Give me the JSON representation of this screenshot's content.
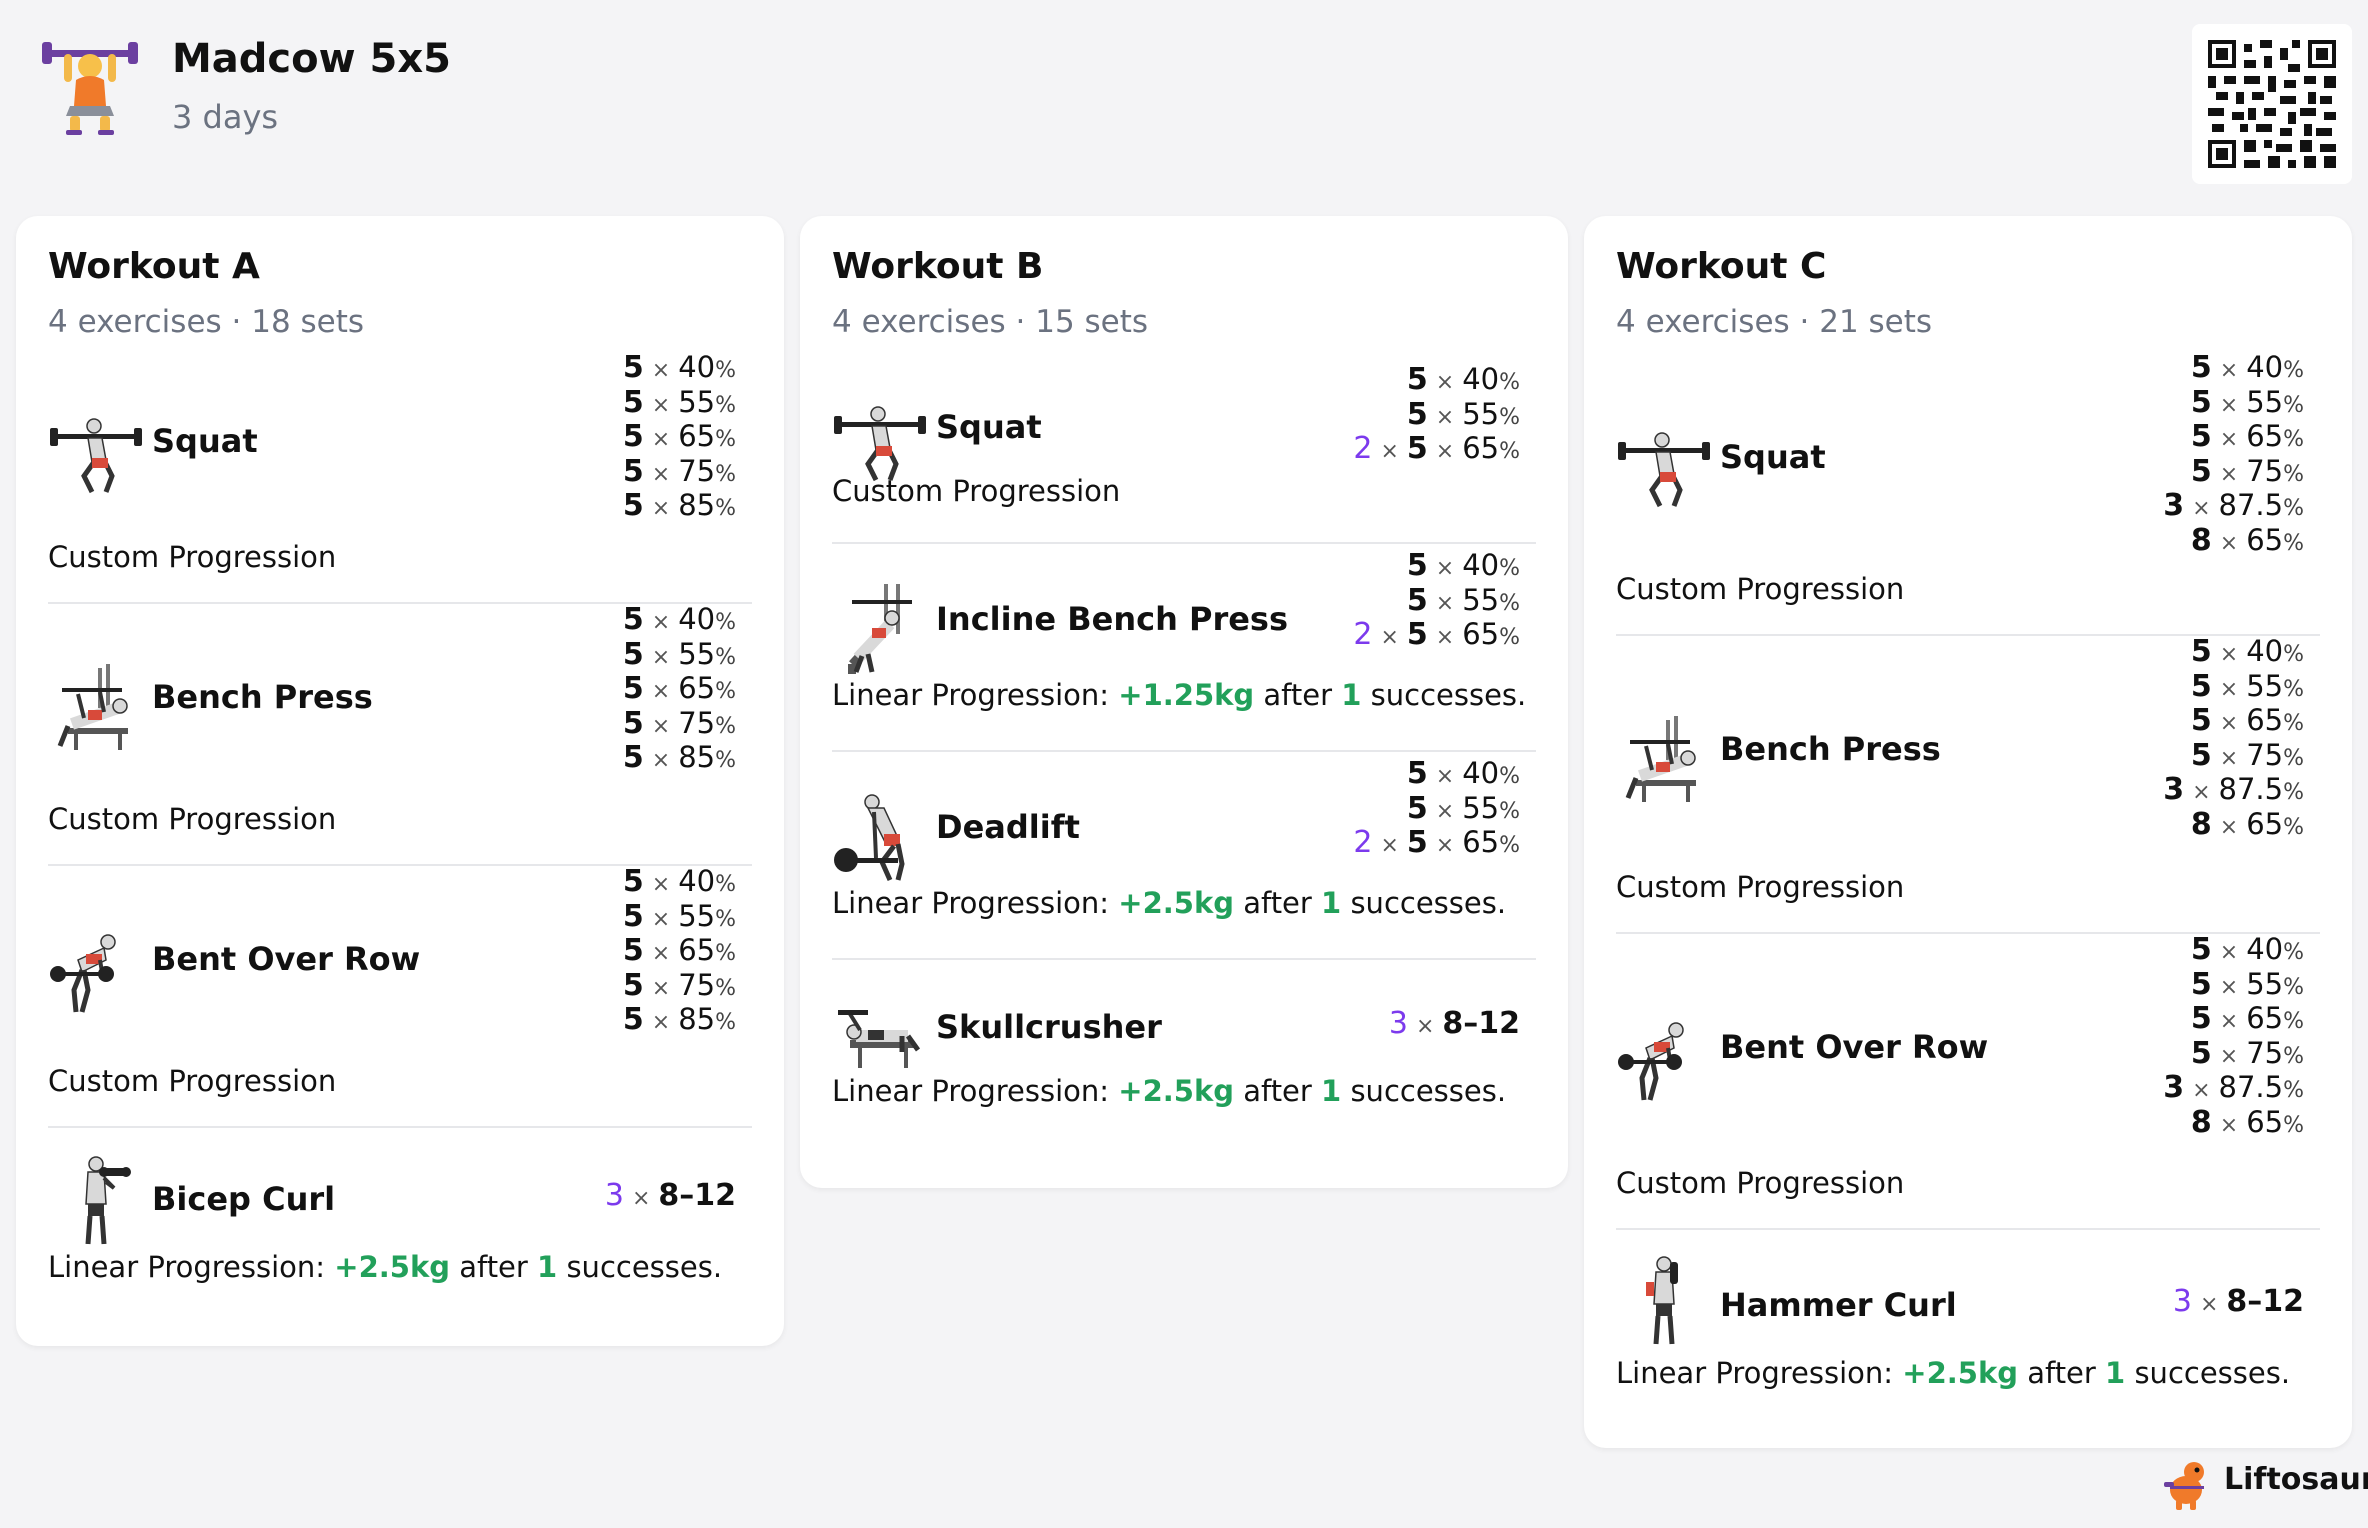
{
  "header": {
    "title": "Madcow 5x5",
    "subtitle": "3 days"
  },
  "workouts": [
    {
      "title": "Workout A",
      "subtitle": "4 exercises · 18 sets",
      "exercises": [
        {
          "name": "Squat",
          "icon": "squat-icon",
          "sets": [
            {
              "reps": "5",
              "pct": "40"
            },
            {
              "reps": "5",
              "pct": "55"
            },
            {
              "reps": "5",
              "pct": "65"
            },
            {
              "reps": "5",
              "pct": "75"
            },
            {
              "reps": "5",
              "pct": "85"
            }
          ],
          "progression": {
            "type": "Custom Progression"
          }
        },
        {
          "name": "Bench Press",
          "icon": "bench-press-icon",
          "sets": [
            {
              "reps": "5",
              "pct": "40"
            },
            {
              "reps": "5",
              "pct": "55"
            },
            {
              "reps": "5",
              "pct": "65"
            },
            {
              "reps": "5",
              "pct": "75"
            },
            {
              "reps": "5",
              "pct": "85"
            }
          ],
          "progression": {
            "type": "Custom Progression"
          }
        },
        {
          "name": "Bent Over Row",
          "icon": "bent-over-row-icon",
          "sets": [
            {
              "reps": "5",
              "pct": "40"
            },
            {
              "reps": "5",
              "pct": "55"
            },
            {
              "reps": "5",
              "pct": "65"
            },
            {
              "reps": "5",
              "pct": "75"
            },
            {
              "reps": "5",
              "pct": "85"
            }
          ],
          "progression": {
            "type": "Custom Progression"
          }
        },
        {
          "name": "Bicep Curl",
          "icon": "bicep-curl-icon",
          "sets": [
            {
              "mult": "3",
              "reps": "8-12"
            }
          ],
          "progression": {
            "label": "Linear Progression:",
            "inc": "+2.5kg",
            "after": "after",
            "count": "1",
            "suffix": "successes."
          }
        }
      ]
    },
    {
      "title": "Workout B",
      "subtitle": "4 exercises · 15 sets",
      "exercises": [
        {
          "name": "Squat",
          "icon": "squat-icon",
          "sets": [
            {
              "reps": "5",
              "pct": "40"
            },
            {
              "reps": "5",
              "pct": "55"
            },
            {
              "mult": "2",
              "reps": "5",
              "pct": "65"
            }
          ],
          "progression": {
            "type": "Custom Progression"
          }
        },
        {
          "name": "Incline Bench Press",
          "icon": "incline-bench-press-icon",
          "sets": [
            {
              "reps": "5",
              "pct": "40"
            },
            {
              "reps": "5",
              "pct": "55"
            },
            {
              "mult": "2",
              "reps": "5",
              "pct": "65"
            }
          ],
          "progression": {
            "label": "Linear Progression:",
            "inc": "+1.25kg",
            "after": "after",
            "count": "1",
            "suffix": "successes."
          }
        },
        {
          "name": "Deadlift",
          "icon": "deadlift-icon",
          "sets": [
            {
              "reps": "5",
              "pct": "40"
            },
            {
              "reps": "5",
              "pct": "55"
            },
            {
              "mult": "2",
              "reps": "5",
              "pct": "65"
            }
          ],
          "progression": {
            "label": "Linear Progression:",
            "inc": "+2.5kg",
            "after": "after",
            "count": "1",
            "suffix": "successes."
          }
        },
        {
          "name": "Skullcrusher",
          "icon": "skullcrusher-icon",
          "sets": [
            {
              "mult": "3",
              "reps": "8-12"
            }
          ],
          "progression": {
            "label": "Linear Progression:",
            "inc": "+2.5kg",
            "after": "after",
            "count": "1",
            "suffix": "successes."
          }
        }
      ]
    },
    {
      "title": "Workout C",
      "subtitle": "4 exercises · 21 sets",
      "exercises": [
        {
          "name": "Squat",
          "icon": "squat-icon",
          "sets": [
            {
              "reps": "5",
              "pct": "40"
            },
            {
              "reps": "5",
              "pct": "55"
            },
            {
              "reps": "5",
              "pct": "65"
            },
            {
              "reps": "5",
              "pct": "75"
            },
            {
              "reps": "3",
              "pct": "87.5"
            },
            {
              "reps": "8",
              "pct": "65"
            }
          ],
          "progression": {
            "type": "Custom Progression"
          }
        },
        {
          "name": "Bench Press",
          "icon": "bench-press-icon",
          "sets": [
            {
              "reps": "5",
              "pct": "40"
            },
            {
              "reps": "5",
              "pct": "55"
            },
            {
              "reps": "5",
              "pct": "65"
            },
            {
              "reps": "5",
              "pct": "75"
            },
            {
              "reps": "3",
              "pct": "87.5"
            },
            {
              "reps": "8",
              "pct": "65"
            }
          ],
          "progression": {
            "type": "Custom Progression"
          }
        },
        {
          "name": "Bent Over Row",
          "icon": "bent-over-row-icon",
          "sets": [
            {
              "reps": "5",
              "pct": "40"
            },
            {
              "reps": "5",
              "pct": "55"
            },
            {
              "reps": "5",
              "pct": "65"
            },
            {
              "reps": "5",
              "pct": "75"
            },
            {
              "reps": "3",
              "pct": "87.5"
            },
            {
              "reps": "8",
              "pct": "65"
            }
          ],
          "progression": {
            "type": "Custom Progression"
          }
        },
        {
          "name": "Hammer Curl",
          "icon": "hammer-curl-icon",
          "sets": [
            {
              "mult": "3",
              "reps": "8-12"
            }
          ],
          "progression": {
            "label": "Linear Progression:",
            "inc": "+2.5kg",
            "after": "after",
            "count": "1",
            "suffix": "successes."
          }
        }
      ]
    }
  ],
  "symbols": {
    "times": "×",
    "percent": "%"
  },
  "brand": {
    "name": "Liftosaur"
  },
  "colors": {
    "accent_purple": "#7c3aed",
    "accent_green": "#22a05a",
    "muted": "#6b7280"
  }
}
